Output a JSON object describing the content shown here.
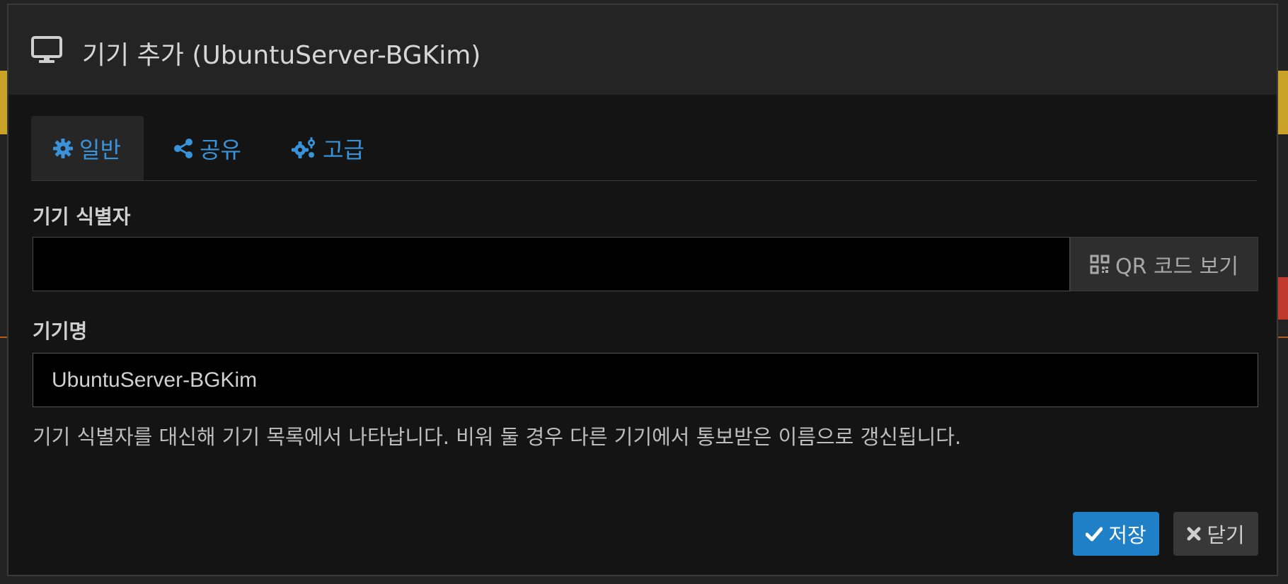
{
  "dialog": {
    "title": "기기 추가 (UbuntuServer-BGKim)",
    "icon": "desktop-icon"
  },
  "tabs": [
    {
      "label": "일반",
      "icon": "gear-icon",
      "active": true
    },
    {
      "label": "공유",
      "icon": "share-icon",
      "active": false
    },
    {
      "label": "고급",
      "icon": "gears-icon",
      "active": false
    }
  ],
  "form": {
    "device_id_label": "기기 식별자",
    "qr_button_label": "QR 코드 보기",
    "qr_icon": "qrcode-icon",
    "device_name_label": "기기명",
    "device_name_value": "UbuntuServer-BGKim",
    "help_text": "기기 식별자를 대신해 기기 목록에서 나타납니다. 비워 둘 경우 다른 기기에서 통보받은 이름으로 갱신됩니다."
  },
  "footer": {
    "save_label": "저장",
    "close_label": "닫기"
  },
  "colors": {
    "accent": "#3a93d8",
    "save_button": "#1f7fc7",
    "close_button": "#383838",
    "background": "#141414",
    "header": "#242424"
  }
}
